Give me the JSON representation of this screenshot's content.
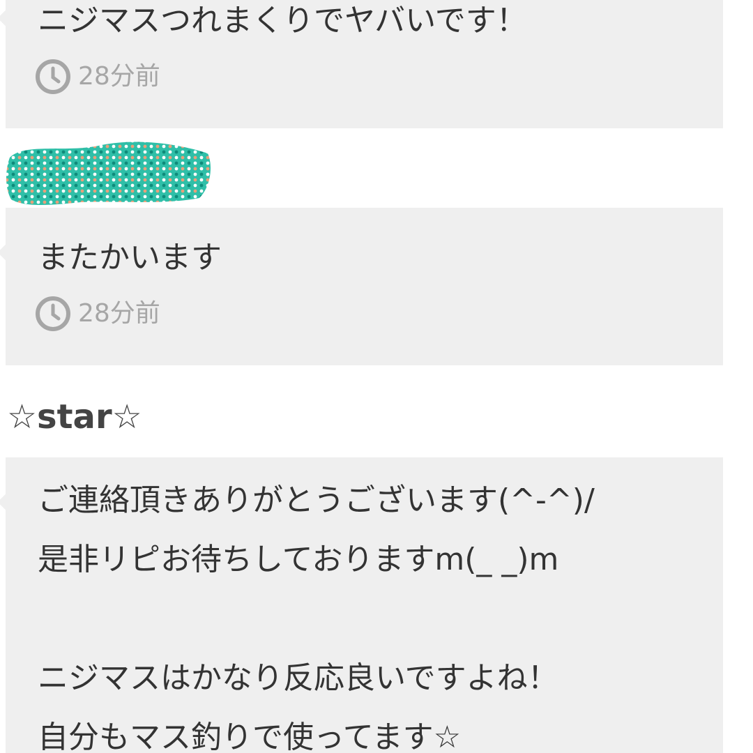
{
  "messages": [
    {
      "text": "ニジマスつれまくりでヤバいです！",
      "time": "28分前"
    },
    {
      "text": "またかいます",
      "time": "28分前"
    }
  ],
  "reply": {
    "username": "☆star☆",
    "lines": [
      "ご連絡頂きありがとうございます(^-^)/",
      "是非リピお待ちしておりますm(_ _)m",
      "",
      "ニジマスはかなり反応良いですよね！",
      "自分もマス釣りで使ってます☆"
    ]
  },
  "icons": {
    "time": "clock-icon",
    "redaction": "dotted-redaction-blob"
  },
  "colors": {
    "bubble": "#efefef",
    "text": "#333333",
    "meta": "#a6a6a6",
    "redaction": "#2fbfa8"
  }
}
